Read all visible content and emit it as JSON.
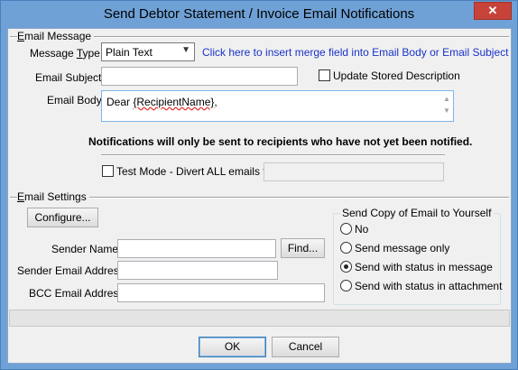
{
  "window": {
    "title": "Send Debtor Statement / Invoice Email Notifications",
    "close_glyph": "✕"
  },
  "email_message": {
    "group_title_first": "E",
    "group_title_rest": "mail Message",
    "message_type_label_a": "Message ",
    "message_type_label_u": "T",
    "message_type_label_b": "ype:",
    "message_type_value": "Plain Text",
    "merge_field_link": "Click here to insert merge field into Email Body or Email Subject",
    "email_subject_label": "Email Subject:",
    "email_subject_value": "",
    "update_desc_label": "Update Stored Description",
    "update_desc_checked": false,
    "email_body_label": "Email Body:",
    "email_body_prefix": "Dear ",
    "email_body_merge": "{RecipientName}",
    "email_body_suffix": ",",
    "notice": "Notifications will only be sent to recipients who have not yet been notified.",
    "test_mode_label": "Test Mode - Divert ALL emails to:",
    "test_mode_checked": false,
    "test_mode_value": ""
  },
  "email_settings": {
    "group_title_first": "E",
    "group_title_rest": "mail Settings",
    "configure_label": "Configure...",
    "sender_name_label": "Sender Name:",
    "sender_name_value": "",
    "find_label": "Find...",
    "sender_email_label": "Sender Email Address:",
    "sender_email_value": "",
    "bcc_label": "BCC Email Address:",
    "bcc_value": ""
  },
  "copy_group": {
    "title": "Send Copy of Email to Yourself",
    "options": [
      {
        "label": "No",
        "checked": false
      },
      {
        "label": "Send message only",
        "checked": false
      },
      {
        "label": "Send with status in message",
        "checked": true
      },
      {
        "label": "Send with status in attachment",
        "checked": false
      }
    ]
  },
  "buttons": {
    "ok": "OK",
    "cancel": "Cancel"
  },
  "icons": {
    "scroll_up": "▲",
    "scroll_down": "▼",
    "dropdown": "▼"
  }
}
